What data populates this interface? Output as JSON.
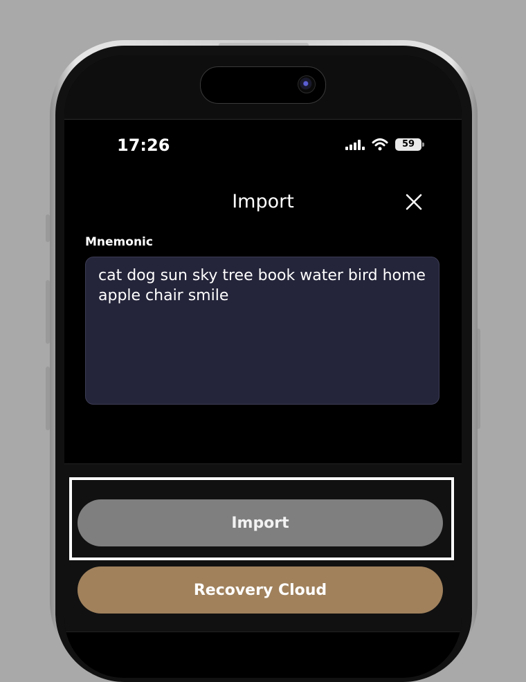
{
  "status_bar": {
    "time": "17:26",
    "battery_level": "59",
    "signal_icon": "cellular-signal-icon",
    "wifi_icon": "wifi-icon"
  },
  "header": {
    "title": "Import",
    "close_icon": "close-icon"
  },
  "mnemonic": {
    "label": "Mnemonic",
    "value": "cat dog sun sky tree book water bird home apple chair smile"
  },
  "actions": {
    "import_label": "Import",
    "recovery_cloud_label": "Recovery Cloud"
  },
  "colors": {
    "background": "#000000",
    "field_background": "#24243a",
    "import_button": "#7f7f7f",
    "recovery_button": "#a0815c",
    "highlight": "#ffffff"
  }
}
